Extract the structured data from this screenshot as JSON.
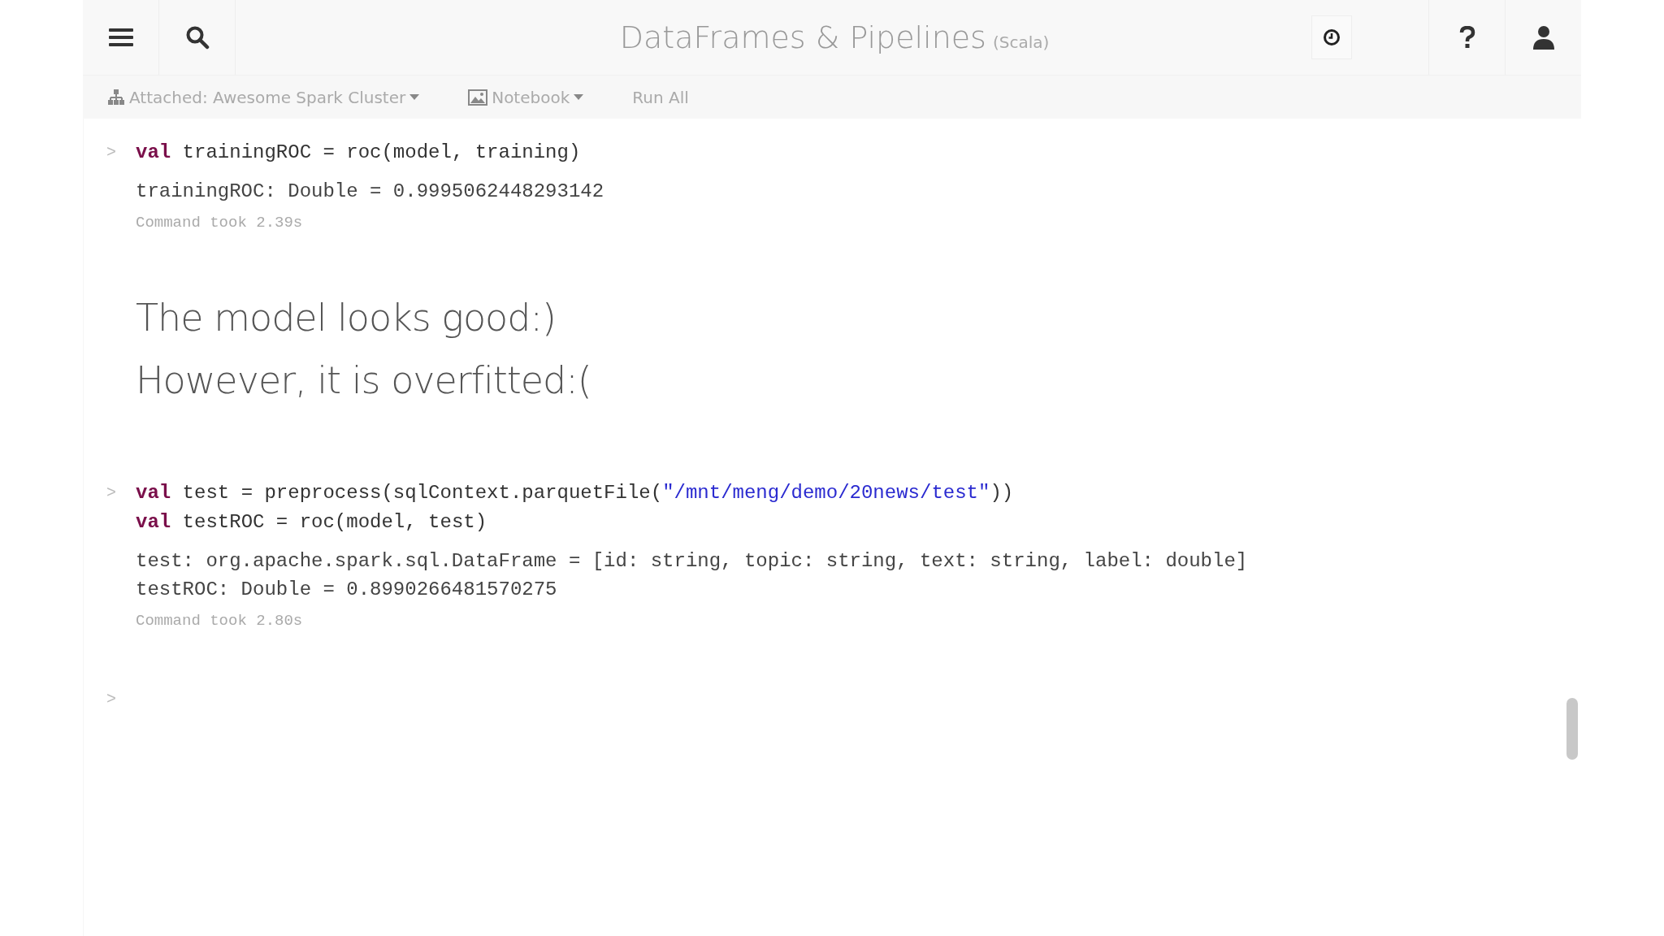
{
  "header": {
    "title": "DataFrames & Pipelines",
    "language": "(Scala)"
  },
  "toolbar": {
    "cluster": "Attached: Awesome Spark Cluster",
    "view": "Notebook",
    "run_all": "Run All"
  },
  "cells": [
    {
      "kind": "code",
      "prompt": ">",
      "lines": [
        [
          {
            "kind": "keyword",
            "text": "val"
          },
          {
            "kind": "plain",
            "text": " trainingROC = roc(model, training)"
          }
        ]
      ],
      "output": [
        "trainingROC: Double = 0.9995062448293142"
      ],
      "timing": "Command took 2.39s"
    },
    {
      "kind": "markdown",
      "lines": [
        "The model looks good:)",
        "However, it is overfitted:("
      ]
    },
    {
      "kind": "code",
      "prompt": ">",
      "lines": [
        [
          {
            "kind": "keyword",
            "text": "val"
          },
          {
            "kind": "plain",
            "text": " test = preprocess(sqlContext.parquetFile("
          },
          {
            "kind": "string",
            "text": "\"/mnt/meng/demo/20news/test\""
          },
          {
            "kind": "plain",
            "text": "))"
          }
        ],
        [
          {
            "kind": "keyword",
            "text": "val"
          },
          {
            "kind": "plain",
            "text": " testROC = roc(model, test)"
          }
        ]
      ],
      "output": [
        "test: org.apache.spark.sql.DataFrame = [id: string, topic: string, text: string, label: double]",
        "testROC: Double = 0.8990266481570275"
      ],
      "timing": "Command took 2.80s"
    },
    {
      "kind": "empty",
      "prompt": ">"
    }
  ]
}
